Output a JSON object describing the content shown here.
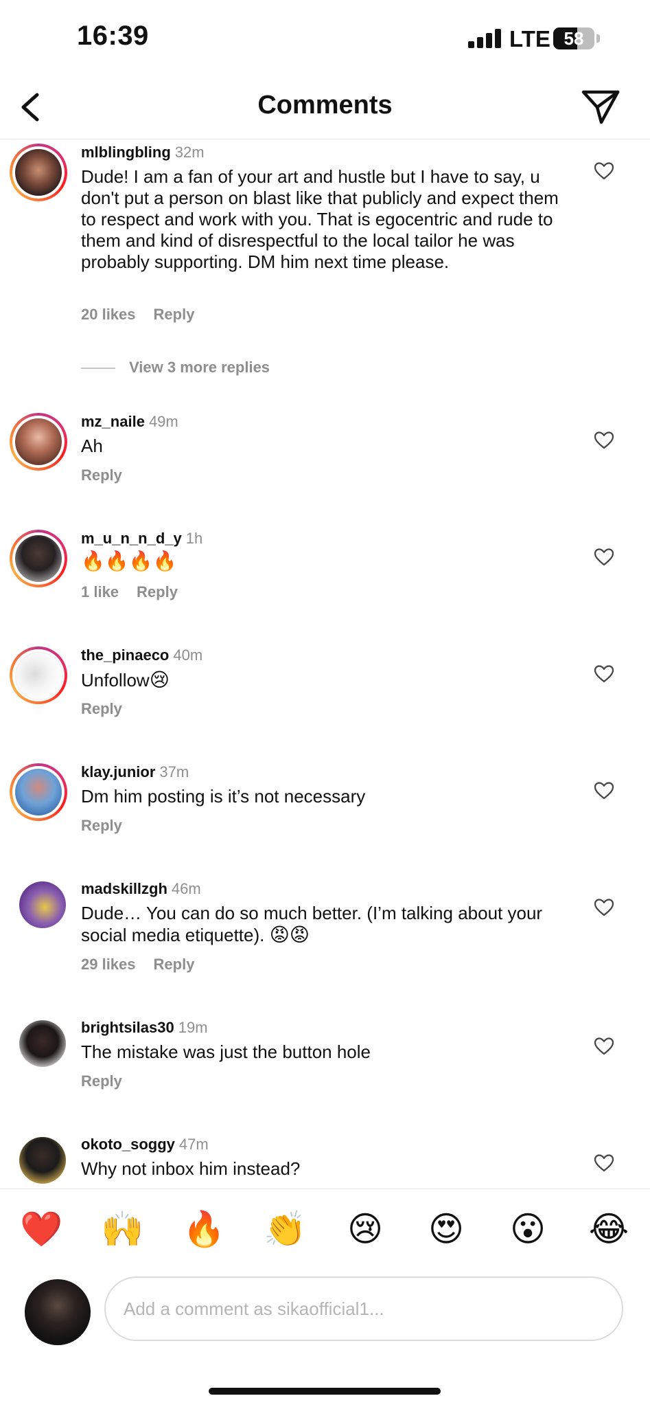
{
  "status_bar": {
    "time": "16:39",
    "network": "LTE",
    "battery": "58"
  },
  "header": {
    "title": "Comments"
  },
  "comments": [
    {
      "username": "mlblingbling",
      "time": "32m",
      "text": "Dude! I am a fan of your art and hustle but I have to say, u don't put a person on blast like that publicly and expect them to respect and work with you. That is egocentric and rude to them and kind of disrespectful to the local tailor he was probably supporting.  DM him next time please.",
      "likes": "20 likes",
      "reply": "Reply",
      "view_replies": "View 3 more replies"
    },
    {
      "username": "mz_naile",
      "time": "49m",
      "text": "Ah",
      "reply": "Reply"
    },
    {
      "username": "m_u_n_n_d_y",
      "time": "1h",
      "text": "🔥🔥🔥🔥",
      "likes": "1 like",
      "reply": "Reply"
    },
    {
      "username": "the_pinaeco",
      "time": "40m",
      "text": "Unfollow",
      "emoji": "😢",
      "reply": "Reply"
    },
    {
      "username": "klay.junior",
      "time": "37m",
      "text": "Dm him posting is it’s not necessary",
      "reply": "Reply"
    },
    {
      "username": "madskillzgh",
      "time": "46m",
      "text": "Dude… You can do so much better. (I’m talking about your social media etiquette).",
      "emoji": "😡😡",
      "likes": "29 likes",
      "reply": "Reply"
    },
    {
      "username": "brightsilas30",
      "time": "19m",
      "text": "The mistake was just the button hole",
      "reply": "Reply"
    },
    {
      "username": "okoto_soggy",
      "time": "47m",
      "text": "Why not inbox him instead?"
    }
  ],
  "reactions": [
    "❤️",
    "🙌",
    "🔥",
    "👏",
    "😢",
    "😍",
    "😮",
    "😂"
  ],
  "composer": {
    "placeholder": "Add a comment as sikaofficial1..."
  },
  "colors": {
    "heart": "#ed4956",
    "muted": "#8e8e8e",
    "ring_start": "#c13584",
    "ring_end": "#fcaf45"
  }
}
